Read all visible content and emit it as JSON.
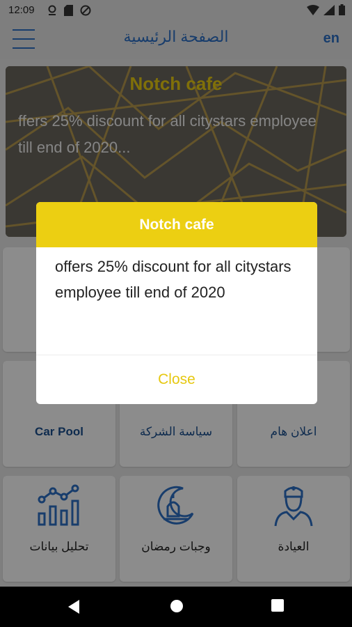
{
  "status_bar": {
    "time": "12:09"
  },
  "app_bar": {
    "title": "الصفحة الرئيسية",
    "lang": "en"
  },
  "banner": {
    "title": "Notch cafe",
    "text": "ffers 25% discount for all citystars employee till end of 2020..."
  },
  "tiles_row2": [
    {
      "label": "Car Pool"
    },
    {
      "label": "سياسة الشركة"
    },
    {
      "label": "اعلان هام"
    }
  ],
  "tiles_row3": [
    {
      "label": "تحليل بيانات",
      "icon": "chart-icon"
    },
    {
      "label": "وجبات رمضان",
      "icon": "ramadan-icon"
    },
    {
      "label": "العيادة",
      "icon": "doctor-icon"
    }
  ],
  "dialog": {
    "title": "Notch cafe",
    "message": "offers 25% discount for all citystars employee till end of 2020",
    "close": "Close"
  },
  "colors": {
    "primary": "#2d6fc5",
    "accent": "#eccf12",
    "label": "#1a4f8f"
  }
}
